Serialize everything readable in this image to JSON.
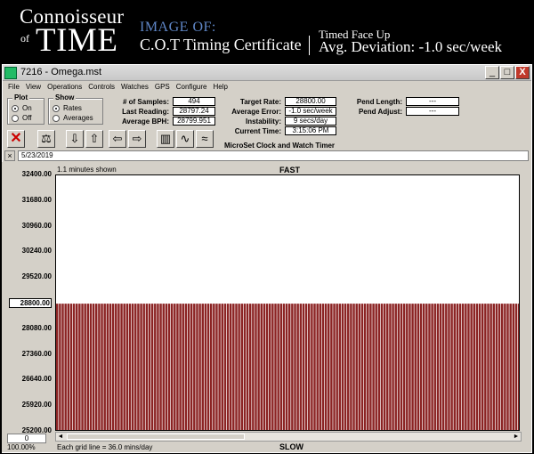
{
  "banner": {
    "brand_top": "Connoisseur",
    "brand_of": "of",
    "brand_main": "TIME",
    "image_of": "IMAGE OF:",
    "certificate": "C.O.T Timing Certificate",
    "position": "Timed Face Up",
    "deviation": "Avg. Deviation: -1.0 sec/week"
  },
  "window": {
    "title": "7216 - Omega.mst",
    "min_glyph": "_",
    "max_glyph": "□",
    "close_glyph": "X"
  },
  "menu": [
    "File",
    "View",
    "Operations",
    "Controls",
    "Watches",
    "GPS",
    "Configure",
    "Help"
  ],
  "plot_group": {
    "title": "Plot",
    "on": "On",
    "off": "Off",
    "selected": "On"
  },
  "show_group": {
    "title": "Show",
    "rates": "Rates",
    "averages": "Averages",
    "selected": "Rates"
  },
  "stats": {
    "samples_label": "# of Samples:",
    "samples": "494",
    "last_label": "Last Reading:",
    "last": "28797.24",
    "bph_label": "Average BPH:",
    "bph": "28799.951",
    "target_label": "Target Rate:",
    "target": "28800.00",
    "avg_err_label": "Average Error:",
    "avg_err": "-1.0 sec/week",
    "instability_label": "Instability:",
    "instability": "9 secs/day",
    "time_label": "Current Time:",
    "time": "3:15:06 PM",
    "pend_len_label": "Pend Length:",
    "pend_len": "---",
    "pend_adj_label": "Pend Adjust:",
    "pend_adj": "---"
  },
  "toolbar": {
    "clear": "✕",
    "scale": "⚖",
    "down": "⇩",
    "up": "⇧",
    "left": "⇦",
    "right": "⇨",
    "bars": "▥",
    "wave": "∿",
    "lines": "≈",
    "caption": "MicroSet Clock and Watch Timer"
  },
  "date": {
    "close": "×",
    "value": "5/23/2019"
  },
  "chart_header": {
    "shown": "1.1 minutes shown",
    "fast": "FAST"
  },
  "chart_footer": {
    "zero": "0",
    "zoom": "100.00%",
    "grid": "Each grid line = 36.0 mins/day",
    "slow": "SLOW",
    "left_arrow": "◄",
    "right_arrow": "►"
  },
  "colors": {
    "bar": "#8b2323",
    "bar_edge": "#5a1010"
  },
  "chart_data": {
    "type": "bar",
    "ylim": [
      25200,
      32400
    ],
    "yticks": [
      "32400.00",
      "31680.00",
      "30960.00",
      "30240.00",
      "29520.00",
      "28800.00",
      "28080.00",
      "27360.00",
      "26640.00",
      "25920.00",
      "25200.00"
    ],
    "reference": "28800.00",
    "bar_count": 166,
    "value": 28797.24
  }
}
